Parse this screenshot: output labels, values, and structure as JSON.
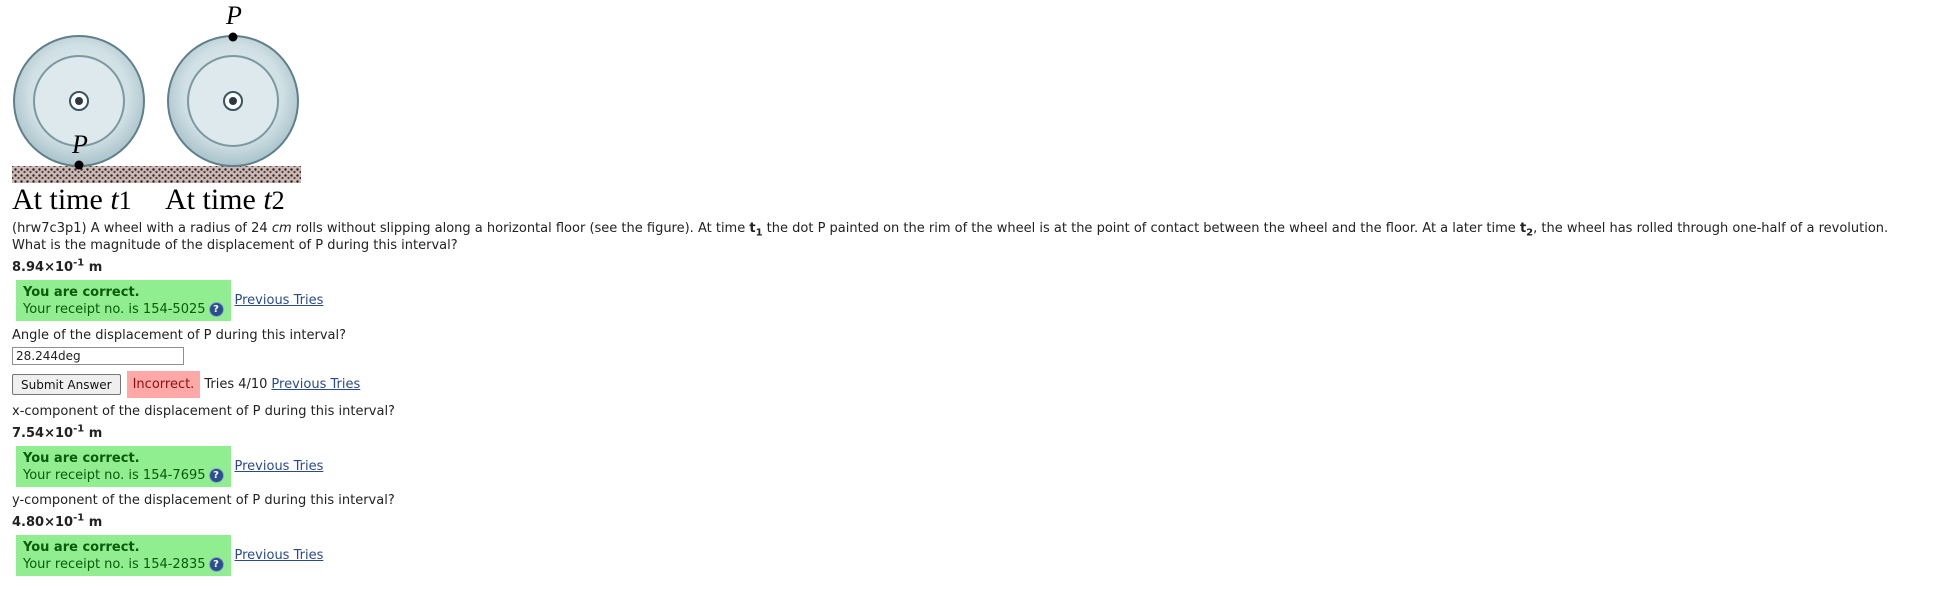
{
  "figure": {
    "label_p_top": "P",
    "label_p_bottom": "P",
    "caption_t1_prefix": "At time ",
    "caption_t1_var": "t",
    "caption_t1_sub": "1",
    "caption_t2_prefix": "At time ",
    "caption_t2_var": "t",
    "caption_t2_sub": "2"
  },
  "problem": {
    "part1": "(hrw7c3p1) A wheel with a radius of 24 ",
    "unit_cm": "cm",
    "part2": " rolls without slipping along a horizontal floor (see the figure). At time ",
    "t1_var": "t",
    "t1_sub": "1",
    "part3": " the dot P painted on the rim of the wheel is at the point of contact between the wheel and the floor. At a later time ",
    "t2_var": "t",
    "t2_sub": "2",
    "part4": ", the wheel has rolled through one-half of a revolution."
  },
  "questions": {
    "q1": {
      "text": "What is the magnitude of the displacement of P during this interval?",
      "answer_base": "8.94×10",
      "answer_exp": "-1",
      "answer_unit": " m",
      "status_title": "You are correct.",
      "receipt": "Your receipt no. is 154-5025",
      "prev_link": "Previous Tries"
    },
    "q2": {
      "text": "Angle of the displacement of P during this interval?",
      "input_value": "28.244deg",
      "submit_label": "Submit Answer",
      "status": "Incorrect.",
      "tries": "Tries 4/10",
      "prev_link": "Previous Tries"
    },
    "q3": {
      "text": "x-component of the displacement of P during this interval?",
      "answer_base": "7.54×10",
      "answer_exp": "-1",
      "answer_unit": " m",
      "status_title": "You are correct.",
      "receipt": "Your receipt no. is 154-7695",
      "prev_link": "Previous Tries"
    },
    "q4": {
      "text": "y-component of the displacement of P during this interval?",
      "answer_base": "4.80×10",
      "answer_exp": "-1",
      "answer_unit": " m",
      "status_title": "You are correct.",
      "receipt": "Your receipt no. is 154-2835",
      "prev_link": "Previous Tries"
    }
  },
  "help_icon_glyph": "?",
  "colors": {
    "correct_bg": "#90ee90",
    "incorrect_bg": "#ffa8a8",
    "link": "#2a4a8a"
  }
}
